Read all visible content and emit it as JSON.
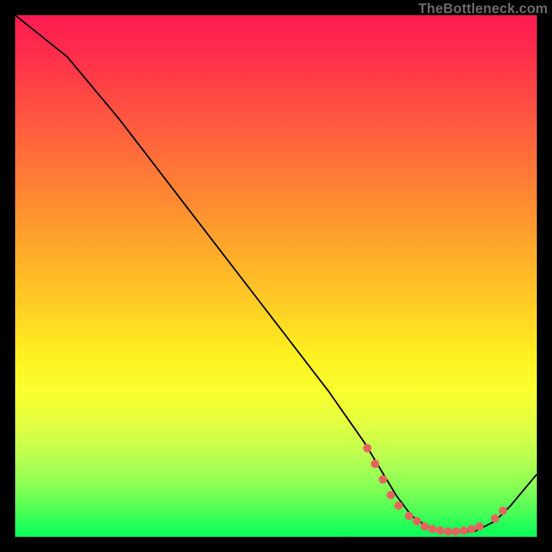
{
  "watermark": "TheBottleneck.com",
  "chart_data": {
    "type": "line",
    "title": "",
    "xlabel": "",
    "ylabel": "",
    "xlim": [
      0,
      100
    ],
    "ylim": [
      0,
      100
    ],
    "series": [
      {
        "name": "curve",
        "x": [
          0,
          5,
          10,
          20,
          30,
          40,
          50,
          60,
          67,
          70,
          73,
          76,
          79,
          82,
          85,
          88,
          90,
          92,
          95,
          100
        ],
        "y": [
          100,
          96,
          92,
          80,
          67,
          54,
          41,
          28,
          18,
          13,
          8,
          4,
          2,
          1,
          1,
          1,
          2,
          3,
          6,
          12
        ]
      }
    ],
    "markers": [
      {
        "x": 67.5,
        "y": 17
      },
      {
        "x": 69.0,
        "y": 14
      },
      {
        "x": 70.5,
        "y": 11
      },
      {
        "x": 72.0,
        "y": 8
      },
      {
        "x": 73.5,
        "y": 6
      },
      {
        "x": 75.5,
        "y": 4
      },
      {
        "x": 77.0,
        "y": 3
      },
      {
        "x": 78.5,
        "y": 2
      },
      {
        "x": 80.0,
        "y": 1.5
      },
      {
        "x": 81.5,
        "y": 1.2
      },
      {
        "x": 83.0,
        "y": 1
      },
      {
        "x": 84.5,
        "y": 1
      },
      {
        "x": 86.0,
        "y": 1.2
      },
      {
        "x": 87.5,
        "y": 1.5
      },
      {
        "x": 89.0,
        "y": 2
      },
      {
        "x": 92.0,
        "y": 3.5
      },
      {
        "x": 93.5,
        "y": 5
      }
    ],
    "colors": {
      "curve": "#000000",
      "marker": "#e6645e"
    }
  }
}
